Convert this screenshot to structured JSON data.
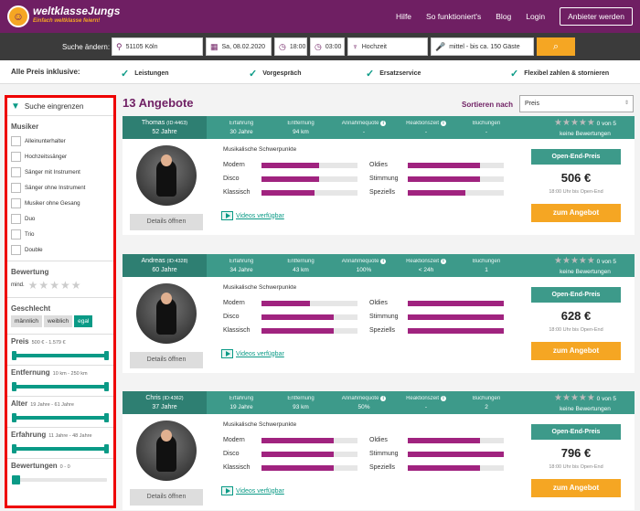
{
  "header": {
    "logo_text": "weltklasseJungs",
    "logo_tagline": "Einfach weltklasse feiern!",
    "nav": [
      "Hilfe",
      "So funktioniert's",
      "Blog",
      "Login"
    ],
    "cta": "Anbieter werden"
  },
  "search": {
    "label": "Suche ändern:",
    "location": "51105 Köln",
    "date": "Sa, 08.02.2020",
    "time_from": "18:00",
    "time_to": "03:00",
    "event": "Hochzeit",
    "guests": "mittel - bis ca. 150 Gäste"
  },
  "inclusive": {
    "title": "Alle Preis inklusive:",
    "items": [
      "Leistungen",
      "Vorgespräch",
      "Ersatzservice",
      "Flexibel zahlen & stornieren"
    ]
  },
  "sidebar": {
    "header": "Suche eingrenzen",
    "musiker_title": "Musiker",
    "musiker": [
      "Alleinunterhalter",
      "Hochzeitssänger",
      "Sänger mit Instrument",
      "Sänger ohne Instrument",
      "Musiker ohne Gesang",
      "Duo",
      "Trio",
      "Double"
    ],
    "bewertung_title": "Bewertung",
    "bewertung_min": "mind.",
    "geschlecht_title": "Geschlecht",
    "geschlecht": [
      "männlich",
      "weiblich",
      "egal"
    ],
    "preis": {
      "title": "Preis",
      "range": "500 € - 1.579 €"
    },
    "entfernung": {
      "title": "Entfernung",
      "range": "10 km - 250 km"
    },
    "alter": {
      "title": "Alter",
      "range": "19 Jahre - 61 Jahre"
    },
    "erfahrung": {
      "title": "Erfahrung",
      "range": "11 Jahre - 48 Jahre"
    },
    "bewertungen": {
      "title": "Bewertungen",
      "range": "0 - 0"
    }
  },
  "results": {
    "count": "13 Angebote",
    "sort_label": "Sortieren nach",
    "sort_value": "Preis"
  },
  "labels": {
    "erfahrung": "Erfahrung",
    "entfernung": "Entfernung",
    "annahme": "Annahmequote",
    "reaktion": "Reaktionszeit",
    "buchungen": "Buchungen",
    "schwerpunkte": "Musikalische Schwerpunkte",
    "details": "Details öffnen",
    "video": "Videos verfügbar",
    "open_end": "Open-End-Preis",
    "price_note": "18:00 Uhr bis Open-End",
    "angebot": "zum Angebot",
    "skills": [
      "Modern",
      "Disco",
      "Klassisch",
      "Oldies",
      "Stimmung",
      "Speziells"
    ]
  },
  "cards": [
    {
      "name": "Thomas",
      "id": "(ID:4463)",
      "age": "52 Jahre",
      "erfahrung": "30 Jahre",
      "entfernung": "94 km",
      "annahme": "-",
      "reaktion": "-",
      "buchungen": "-",
      "rating": "0 von 5",
      "reviews": "keine Bewertungen",
      "price": "506 €",
      "skills": [
        0.6,
        0.6,
        0.55,
        0.75,
        0.75,
        0.6
      ]
    },
    {
      "name": "Andreas",
      "id": "(ID:4328)",
      "age": "60 Jahre",
      "erfahrung": "34 Jahre",
      "entfernung": "43 km",
      "annahme": "100%",
      "reaktion": "< 24h",
      "buchungen": "1",
      "rating": "0 von 5",
      "reviews": "keine Bewertungen",
      "price": "628 €",
      "skills": [
        0.5,
        0.75,
        0.75,
        1.0,
        1.0,
        1.0
      ]
    },
    {
      "name": "Chris",
      "id": "(ID:4362)",
      "age": "37 Jahre",
      "erfahrung": "19 Jahre",
      "entfernung": "93 km",
      "annahme": "50%",
      "reaktion": "-",
      "buchungen": "2",
      "rating": "0 von 5",
      "reviews": "keine Bewertungen",
      "price": "796 €",
      "skills": [
        0.75,
        0.75,
        0.75,
        0.75,
        1.0,
        0.75
      ]
    }
  ]
}
